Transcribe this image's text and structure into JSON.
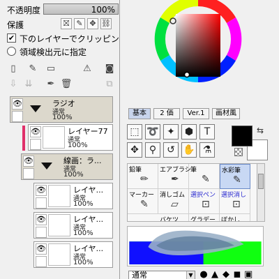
{
  "opacity": {
    "label": "不透明度",
    "value": "100%",
    "fraction": 1.0
  },
  "protect": {
    "label": "保護",
    "buttons": [
      {
        "icon": "transparency-lock-icon",
        "glyph": "⛝"
      },
      {
        "icon": "brush-lock-icon",
        "glyph": "✎"
      },
      {
        "icon": "move-lock-icon",
        "glyph": "✥"
      },
      {
        "icon": "all-lock-icon",
        "glyph": "⛓"
      }
    ]
  },
  "clipping": {
    "label": "下のレイヤーでクリッピング",
    "checked": "✔"
  },
  "selection_source": {
    "label": "領域検出元に指定"
  },
  "layer_toolbar_top": [
    {
      "icon": "new-layer-icon",
      "glyph": "▯"
    },
    {
      "icon": "new-vector-layer-icon",
      "glyph": "✎"
    },
    {
      "icon": "new-folder-icon",
      "glyph": "▭"
    },
    {
      "icon": "new-linework-layer-icon",
      "glyph": "⚠"
    },
    {
      "icon": "layer-mask-icon",
      "glyph": "◙"
    }
  ],
  "layer_toolbar_bottom": [
    {
      "icon": "transfer-down-icon",
      "glyph": "⇩"
    },
    {
      "icon": "merge-down-icon",
      "glyph": "⇊"
    },
    {
      "icon": "clear-layer-icon",
      "glyph": "✒"
    },
    {
      "icon": "delete-layer-icon",
      "glyph": "🗑"
    },
    {
      "icon": "combine-icon",
      "glyph": "⧉"
    }
  ],
  "layers": [
    {
      "name": "ラジオ",
      "mode": "通常",
      "opacity": "100%",
      "type": "folder"
    },
    {
      "name": "レイヤー77",
      "mode": "通常",
      "opacity": "100%",
      "type": "layer"
    },
    {
      "name": "線画：ラ...",
      "mode": "通常",
      "opacity": "100%",
      "type": "folder"
    },
    {
      "name": "レイヤ...",
      "mode": "通常",
      "opacity": "100%",
      "type": "layer"
    },
    {
      "name": "レイヤ...",
      "mode": "通常",
      "opacity": "100%",
      "type": "layer"
    },
    {
      "name": "レイヤ...",
      "mode": "通常",
      "opacity": "100%",
      "type": "layer"
    }
  ],
  "color_tabs": [
    "基本",
    "2 価",
    "Ver.1",
    "画材風"
  ],
  "tools": [
    {
      "icon": "rect-select-icon",
      "glyph": "⬚"
    },
    {
      "icon": "lasso-icon",
      "glyph": "➰"
    },
    {
      "icon": "magic-wand-icon",
      "glyph": "✦"
    },
    {
      "icon": "fill-icon",
      "glyph": "⬢"
    },
    {
      "icon": "text-icon",
      "glyph": "T"
    },
    {
      "icon": "move-icon",
      "glyph": "✥"
    },
    {
      "icon": "zoom-icon",
      "glyph": "⚲"
    },
    {
      "icon": "rotate-icon",
      "glyph": "↺"
    },
    {
      "icon": "hand-icon",
      "glyph": "✋"
    },
    {
      "icon": "eyedropper-icon",
      "glyph": "⚗"
    }
  ],
  "brushes": [
    {
      "name": "鉛筆",
      "icon": "pencil-brush-icon",
      "glyph": "✏",
      "blue": false
    },
    {
      "name": "エアブラシ",
      "icon": "airbrush-icon",
      "glyph": "✒",
      "blue": false
    },
    {
      "name": "筆",
      "icon": "brush-icon",
      "glyph": "✎",
      "blue": false
    },
    {
      "name": "水彩筆",
      "icon": "watercolor-icon",
      "glyph": "✎",
      "blue": false,
      "active": true
    },
    {
      "name": "マーカー",
      "icon": "marker-icon",
      "glyph": "✎",
      "blue": false
    },
    {
      "name": "消しゴム",
      "icon": "eraser-icon",
      "glyph": "▱",
      "blue": false
    },
    {
      "name": "選択ペン",
      "icon": "selection-pen-icon",
      "glyph": "⊡",
      "blue": true
    },
    {
      "name": "選択消し",
      "icon": "selection-erase-icon",
      "glyph": "⊡",
      "blue": true
    },
    {
      "name": "バケツ",
      "icon": "bucket-icon",
      "glyph": "",
      "blue": false
    },
    {
      "name": "グラデー",
      "icon": "gradient-icon",
      "glyph": "",
      "blue": false
    },
    {
      "name": "ぼかし",
      "icon": "blur-icon",
      "glyph": "",
      "blue": false
    }
  ],
  "blend_mode": "通常",
  "brush_tips": [
    "●",
    "▲",
    "◆",
    "◼",
    "▣"
  ]
}
